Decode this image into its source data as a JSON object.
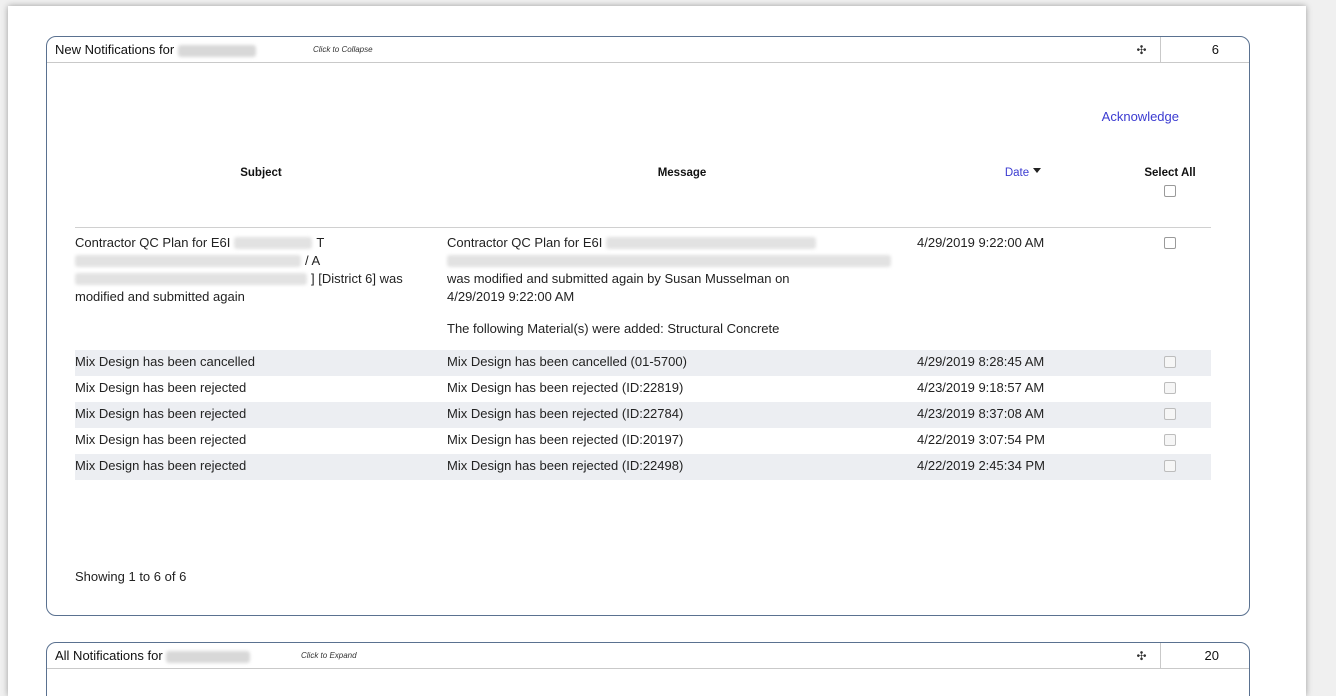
{
  "new_panel": {
    "title": "New Notifications for",
    "hint": "Click to Collapse",
    "count": "6",
    "move_icon": "move-arrows-icon",
    "acknowledge_label": "Acknowledge",
    "columns": {
      "subject": "Subject",
      "message": "Message",
      "date": "Date",
      "select_all": "Select All"
    },
    "first_row": {
      "subject_line1": "Contractor QC Plan for E6I",
      "subject_line1_tail": "T",
      "subject_line2_tail": "/ A",
      "subject_line3_tail": "] [District 6] was",
      "subject_line4": "modified and submitted again",
      "message_line1": "Contractor QC Plan for E6I",
      "message_line3": "was modified and submitted again by Susan Musselman on",
      "message_line4": "4/29/2019 9:22:00 AM",
      "message_line5": "The following Material(s) were added: Structural Concrete",
      "date": "4/29/2019 9:22:00 AM"
    },
    "rows": [
      {
        "subject": "Mix Design has been cancelled",
        "message": "Mix Design has been cancelled (01-5700)",
        "date": "4/29/2019 8:28:45 AM"
      },
      {
        "subject": "Mix Design has been rejected",
        "message": "Mix Design has been rejected (ID:22819)",
        "date": "4/23/2019 9:18:57 AM"
      },
      {
        "subject": "Mix Design has been rejected",
        "message": "Mix Design has been rejected (ID:22784)",
        "date": "4/23/2019 8:37:08 AM"
      },
      {
        "subject": "Mix Design has been rejected",
        "message": "Mix Design has been rejected (ID:20197)",
        "date": "4/22/2019 3:07:54 PM"
      },
      {
        "subject": "Mix Design has been rejected",
        "message": "Mix Design has been rejected (ID:22498)",
        "date": "4/22/2019 2:45:34 PM"
      }
    ],
    "showing": "Showing 1 to 6 of 6"
  },
  "all_panel": {
    "title": "All Notifications for",
    "hint": "Click to Expand",
    "count": "20",
    "move_icon": "move-arrows-icon"
  },
  "colors": {
    "panel_border": "#5a7190",
    "link": "#3b3bd1",
    "row_shade": "#eceef2"
  }
}
